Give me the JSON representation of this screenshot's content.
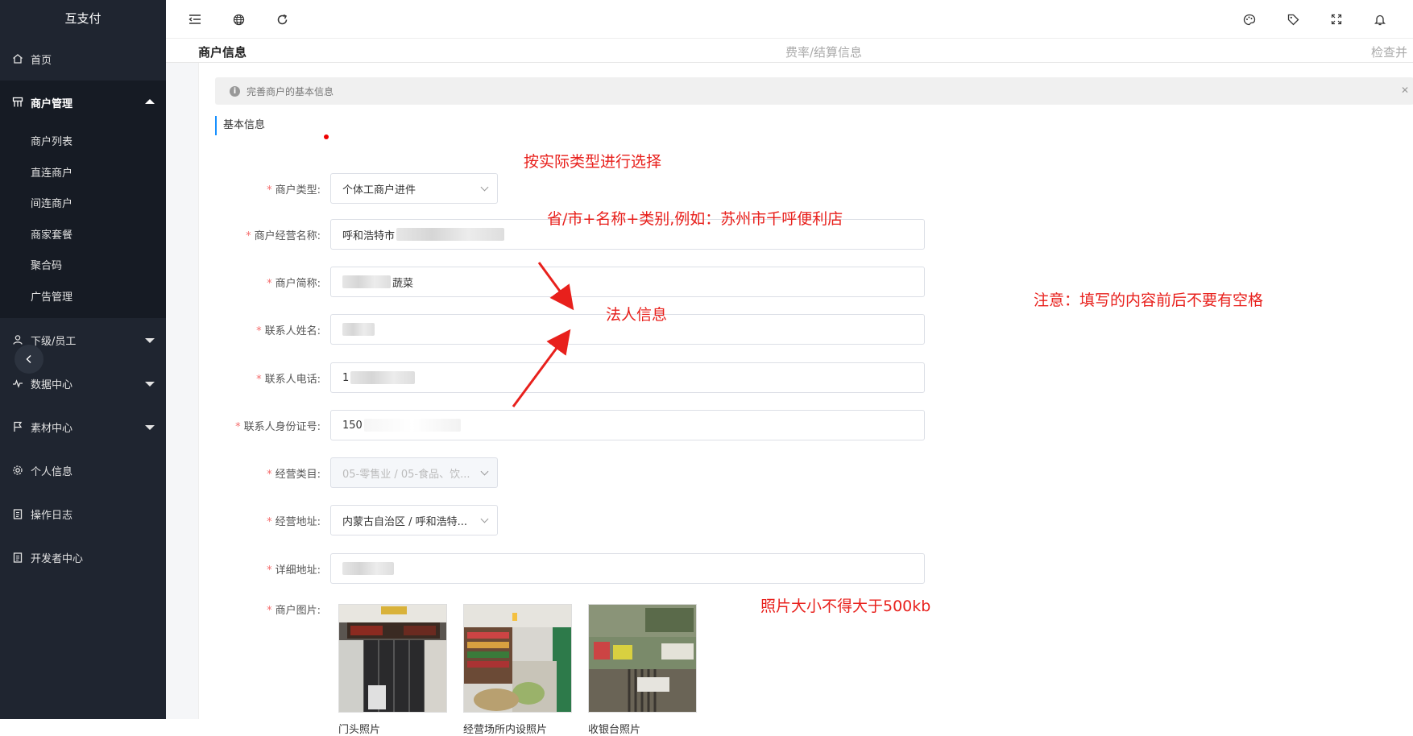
{
  "app": {
    "title": "互支付"
  },
  "sidebar": {
    "items": [
      {
        "label": "首页",
        "icon": "home-icon"
      },
      {
        "label": "商户管理",
        "icon": "grid-icon",
        "expanded": true,
        "children": [
          "商户列表",
          "直连商户",
          "间连商户",
          "商家套餐",
          "聚合码",
          "广告管理"
        ]
      },
      {
        "label": "下级/员工",
        "icon": "user-icon"
      },
      {
        "label": "数据中心",
        "icon": "pulse-icon"
      },
      {
        "label": "素材中心",
        "icon": "flag-icon"
      },
      {
        "label": "个人信息",
        "icon": "gear-icon"
      },
      {
        "label": "操作日志",
        "icon": "clipboard-icon"
      },
      {
        "label": "开发者中心",
        "icon": "clipboard-icon"
      }
    ]
  },
  "steps": {
    "step1": "商户信息",
    "step2": "费率/结算信息",
    "step3": "检查并提"
  },
  "alert": {
    "text": "完善商户的基本信息"
  },
  "section": {
    "title": "基本信息"
  },
  "form": {
    "merchant_type": {
      "label": "商户类型:",
      "value": "个体工商户进件"
    },
    "business_name": {
      "label": "商户经营名称:",
      "value": "呼和浩特市"
    },
    "short_name": {
      "label": "商户简称:",
      "value": "蔬菜"
    },
    "contact_name": {
      "label": "联系人姓名:",
      "value": ""
    },
    "contact_phone": {
      "label": "联系人电话:",
      "value": "1"
    },
    "contact_id": {
      "label": "联系人身份证号:",
      "value": "150"
    },
    "category": {
      "label": "经营类目:",
      "value": "05-零售业 / 05-食品、饮..."
    },
    "address": {
      "label": "经营地址:",
      "value": "内蒙古自治区 / 呼和浩特..."
    },
    "detail_address": {
      "label": "详细地址:",
      "value": ""
    },
    "photos": {
      "label": "商户图片:",
      "captions": [
        "门头照片",
        "经营场所内设照片",
        "收银台照片"
      ]
    }
  },
  "annotations": {
    "select_type": "按实际类型进行选择",
    "name_format": "省/市+名称+类别,例如：苏州市千呼便利店",
    "legal_info": "法人信息",
    "no_spaces": "注意：填写的内容前后不要有空格",
    "photo_size": "照片大小不得大于500kb"
  },
  "colors": {
    "sidebar_bg": "#1f2530",
    "annotation": "#e8201c",
    "required": "#f56c6c",
    "accent": "#1890ff"
  }
}
